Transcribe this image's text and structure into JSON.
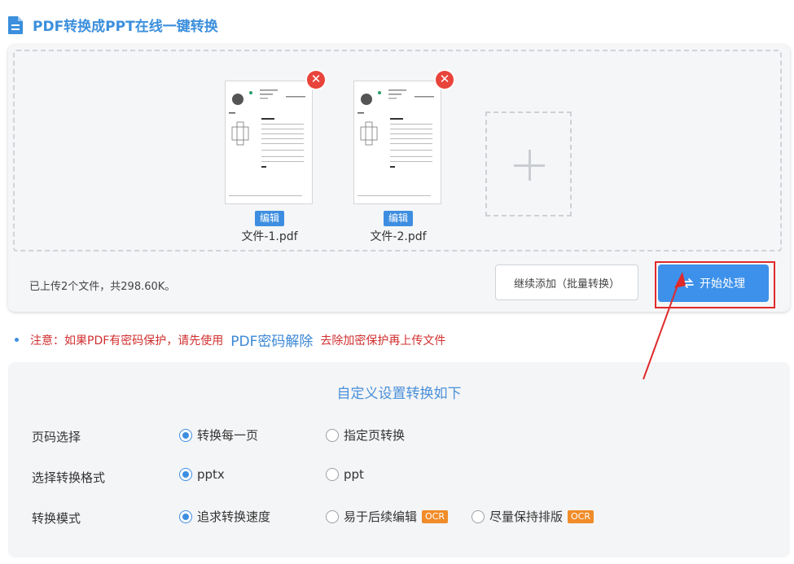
{
  "header": {
    "title": "PDF转换成PPT在线一键转换",
    "icon": "document-icon"
  },
  "files": [
    {
      "name": "文件-1.pdf",
      "edit_label": "编辑",
      "remove_label": "✕"
    },
    {
      "name": "文件-2.pdf",
      "edit_label": "编辑",
      "remove_label": "✕"
    }
  ],
  "upload": {
    "status": "已上传2个文件，共298.60K。",
    "continue_label": "继续添加（批量转换）",
    "start_label": "开始处理"
  },
  "notice": {
    "prefix": "注意：如果PDF有密码保护，请先使用",
    "link": "PDF密码解除",
    "suffix": "去除加密保护再上传文件"
  },
  "settings": {
    "title": "自定义设置转换如下",
    "rows": [
      {
        "label": "页码选择",
        "options": [
          {
            "label": "转换每一页",
            "selected": true
          },
          {
            "label": "指定页转换",
            "selected": false
          }
        ]
      },
      {
        "label": "选择转换格式",
        "options": [
          {
            "label": "pptx",
            "selected": true
          },
          {
            "label": "ppt",
            "selected": false
          }
        ]
      },
      {
        "label": "转换模式",
        "options": [
          {
            "label": "追求转换速度",
            "selected": true
          },
          {
            "label": "易于后续编辑",
            "selected": false,
            "badge": "OCR"
          },
          {
            "label": "尽量保持排版",
            "selected": false,
            "badge": "OCR"
          }
        ]
      }
    ]
  },
  "colors": {
    "accent": "#3d8ee0",
    "danger": "#e8443b",
    "warning": "#d22f2f",
    "ocr_badge": "#f08c2a",
    "annotation": "#e02a2a"
  }
}
